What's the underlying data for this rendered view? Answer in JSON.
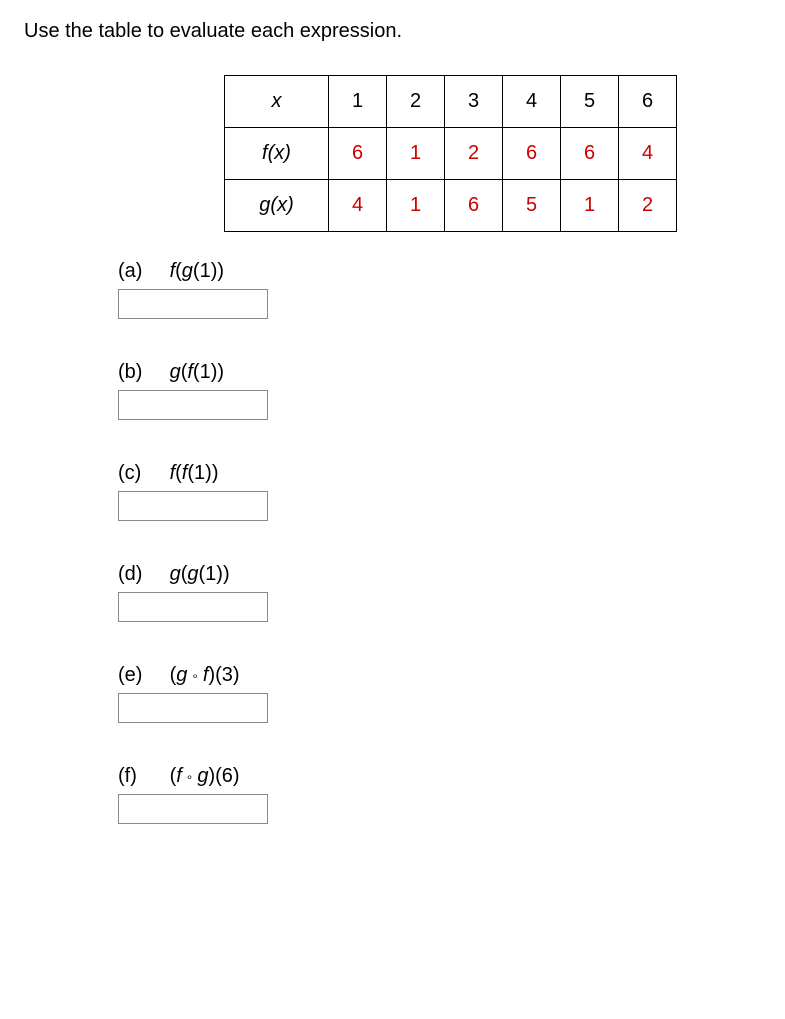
{
  "instruction": "Use the table to evaluate each expression.",
  "table": {
    "header": {
      "x": "x",
      "c1": "1",
      "c2": "2",
      "c3": "3",
      "c4": "4",
      "c5": "5",
      "c6": "6"
    },
    "row_f": {
      "label": "f(x)",
      "v1": "6",
      "v2": "1",
      "v3": "2",
      "v4": "6",
      "v5": "6",
      "v6": "4"
    },
    "row_g": {
      "label": "g(x)",
      "v1": "4",
      "v2": "1",
      "v3": "6",
      "v4": "5",
      "v5": "1",
      "v6": "2"
    }
  },
  "questions": {
    "a": {
      "letter": "(a)",
      "pre": "f",
      "mid": "g",
      "arg": "1"
    },
    "b": {
      "letter": "(b)",
      "pre": "g",
      "mid": "f",
      "arg": "1"
    },
    "c": {
      "letter": "(c)",
      "pre": "f",
      "mid": "f",
      "arg": "1"
    },
    "d": {
      "letter": "(d)",
      "pre": "g",
      "mid": "g",
      "arg": "1"
    },
    "e": {
      "letter": "(e)",
      "f1": "g",
      "f2": "f",
      "arg": "3"
    },
    "f": {
      "letter": "(f)",
      "f1": "f",
      "f2": "g",
      "arg": "6"
    }
  }
}
